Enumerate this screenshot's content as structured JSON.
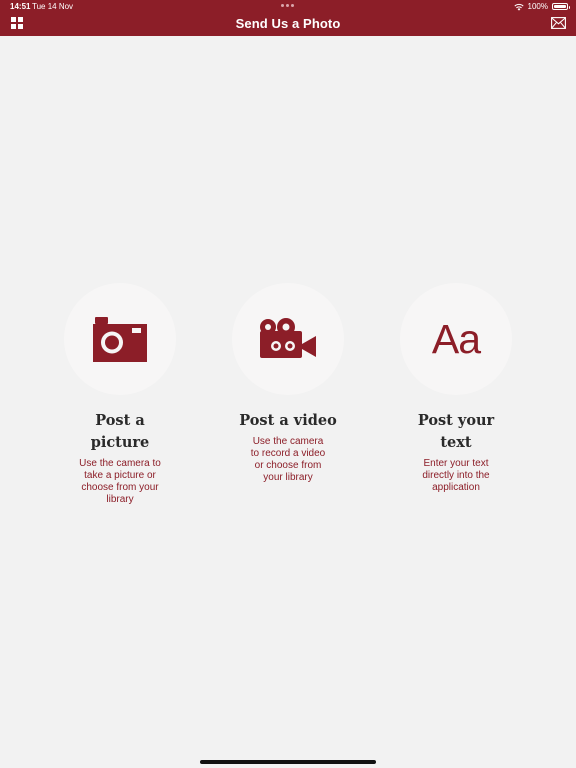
{
  "status_bar": {
    "time": "14:51",
    "date": "Tue 14 Nov",
    "battery": "100%",
    "battery_level": 1.0
  },
  "header": {
    "title": "Send Us a Photo",
    "menu_icon": "grid-icon",
    "mail_icon": "mail-icon"
  },
  "options": [
    {
      "icon": "camera-icon",
      "title": "Post a picture",
      "description": "Use the camera to take a picture or choose from your library"
    },
    {
      "icon": "video-camera-icon",
      "title": "Post a video",
      "description": "Use the camera to record a video or choose from your library"
    },
    {
      "icon": "text-icon",
      "icon_text": "Aa",
      "title": "Post your text",
      "description": "Enter your text directly into the application"
    }
  ],
  "colors": {
    "brand": "#8c1e28",
    "background": "#f2f2f2",
    "circle": "#f7f6f6",
    "title_text": "#2a2a2a"
  }
}
